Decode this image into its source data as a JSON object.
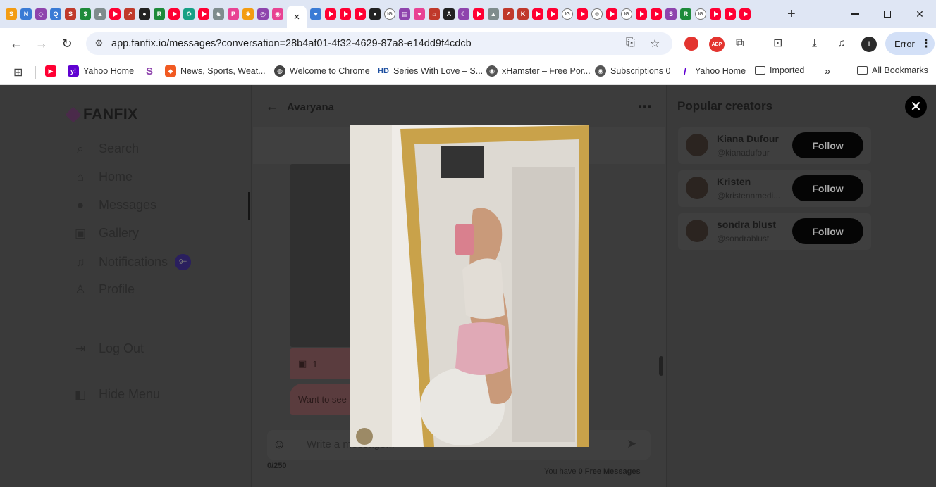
{
  "browser": {
    "active_tab_close": "×",
    "new_tab": "+",
    "url": "app.fanfix.io/messages?conversation=28b4af01-4f32-4629-87a8-e14dd9f4cdcb",
    "profile_initial": "I",
    "error_label": "Error",
    "bookmarks": [
      {
        "label": "Yahoo Home"
      },
      {
        "label": "News, Sports, Weat..."
      },
      {
        "label": "Welcome to Chrome"
      },
      {
        "label": "Series With Love – S..."
      },
      {
        "label": "xHamster – Free Por..."
      },
      {
        "label": "Subscriptions 0"
      },
      {
        "label": "Yahoo Home"
      },
      {
        "label": "Imported"
      },
      {
        "label": "All Bookmarks"
      }
    ],
    "bookmark_overflow": "»"
  },
  "app": {
    "logo": "FANFIX",
    "nav": [
      {
        "label": "Search"
      },
      {
        "label": "Home"
      },
      {
        "label": "Messages"
      },
      {
        "label": "Gallery"
      },
      {
        "label": "Notifications",
        "badge": "9+"
      },
      {
        "label": "Profile"
      },
      {
        "label": "Log Out"
      },
      {
        "label": "Hide Menu"
      }
    ],
    "chat": {
      "name": "Avaryana",
      "media_count": "1",
      "message_preview": "Want to see",
      "composer_placeholder": "Write a message...",
      "char_count": "0/250",
      "free_prefix": "You have",
      "free_count": "0 Free Messages"
    },
    "popular": {
      "title": "Popular creators",
      "creators": [
        {
          "name": "Kiana Dufour",
          "handle": "@kianadufour",
          "button": "Follow"
        },
        {
          "name": "Kristen",
          "handle": "@kristennmedi...",
          "button": "Follow"
        },
        {
          "name": "sondra blust",
          "handle": "@sondrablust",
          "button": "Follow"
        }
      ]
    }
  },
  "colors": {
    "overlay_page": "#3a3a3a",
    "follow_button": "#050505",
    "badge": "#2a1f5e",
    "close_button": "#000000"
  }
}
